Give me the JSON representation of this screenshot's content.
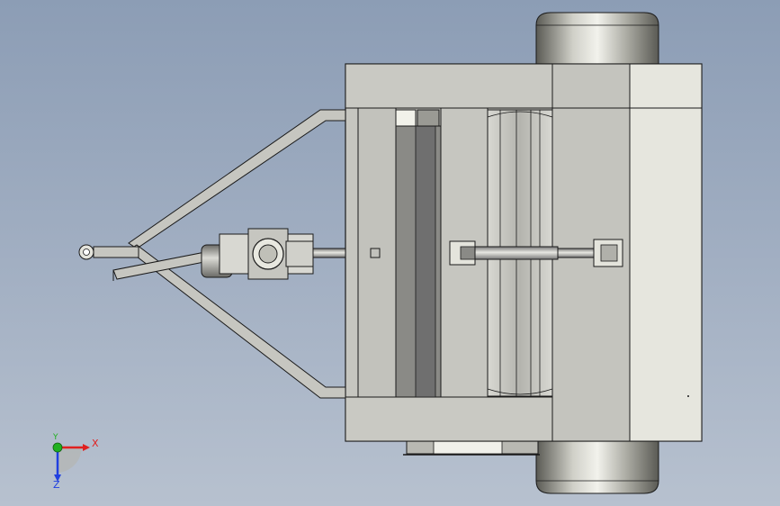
{
  "viewport": {
    "background_top": "#8c9db5",
    "background_bottom": "#b7c1cf"
  },
  "model": {
    "frame_color": "#c6c6c0",
    "frame_dark": "#aeaea8",
    "frame_light": "#e6e6de",
    "edge_color": "#1a1a1a",
    "roller_color": "#6f6f6f",
    "wheel_light": "#f2f2ec",
    "wheel_dark": "#55554f",
    "parts": [
      "left-wheel",
      "right-wheel",
      "main-frame",
      "drawbar-a-frame",
      "tow-hitch",
      "pto-shaft",
      "universal-joint",
      "center-shaft",
      "front-roller",
      "rear-roller",
      "side-panel"
    ]
  },
  "triad": {
    "x_label": "X",
    "y_label": "Y",
    "z_label": "Z",
    "x_color": "#e02020",
    "y_color": "#20b020",
    "z_color": "#2040e0"
  }
}
